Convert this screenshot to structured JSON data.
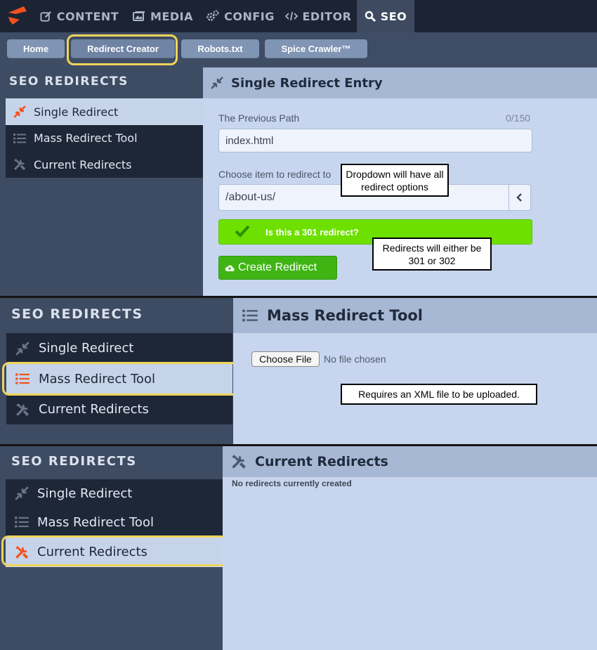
{
  "nav": {
    "items": [
      {
        "label": "CONTENT",
        "icon": "edit-icon"
      },
      {
        "label": "MEDIA",
        "icon": "image-icon"
      },
      {
        "label": "CONFIG",
        "icon": "gears-icon"
      },
      {
        "label": "EDITOR",
        "icon": "code-icon"
      },
      {
        "label": "SEO",
        "icon": "search-icon"
      }
    ],
    "active": "SEO"
  },
  "subtabs": [
    "Home",
    "Redirect Creator",
    "Robots.txt",
    "Spice Crawler™"
  ],
  "sidebar": {
    "title": "SEO REDIRECTS",
    "items": [
      "Single Redirect",
      "Mass Redirect Tool",
      "Current Redirects"
    ]
  },
  "single": {
    "heading": "Single Redirect Entry",
    "prev_label": "The Previous Path",
    "counter": "0/150",
    "prev_value": "index.html",
    "choose_label": "Choose item to redirect to",
    "select_value": "/about-us/",
    "toggle_label": "Is this a 301 redirect?",
    "create_label": "Create Redirect",
    "note_dropdown": "Dropdown will have all redirect options",
    "note_redirect": "Redirects will either be 301 or 302"
  },
  "mass": {
    "heading": "Mass Redirect Tool",
    "choose_file": "Choose File",
    "no_file": "No file chosen",
    "note": "Requires an XML file to be uploaded."
  },
  "current": {
    "heading": "Current Redirects",
    "empty": "No redirects currently created"
  },
  "colors": {
    "accent": "#f4511e",
    "sidebar_bg": "#3e4c63",
    "menu_bg": "#1e2738",
    "content_bg": "#c7d6ee",
    "highlight": "#efd45a",
    "toggle_green": "#6ee000",
    "button_green": "#3fb514"
  }
}
